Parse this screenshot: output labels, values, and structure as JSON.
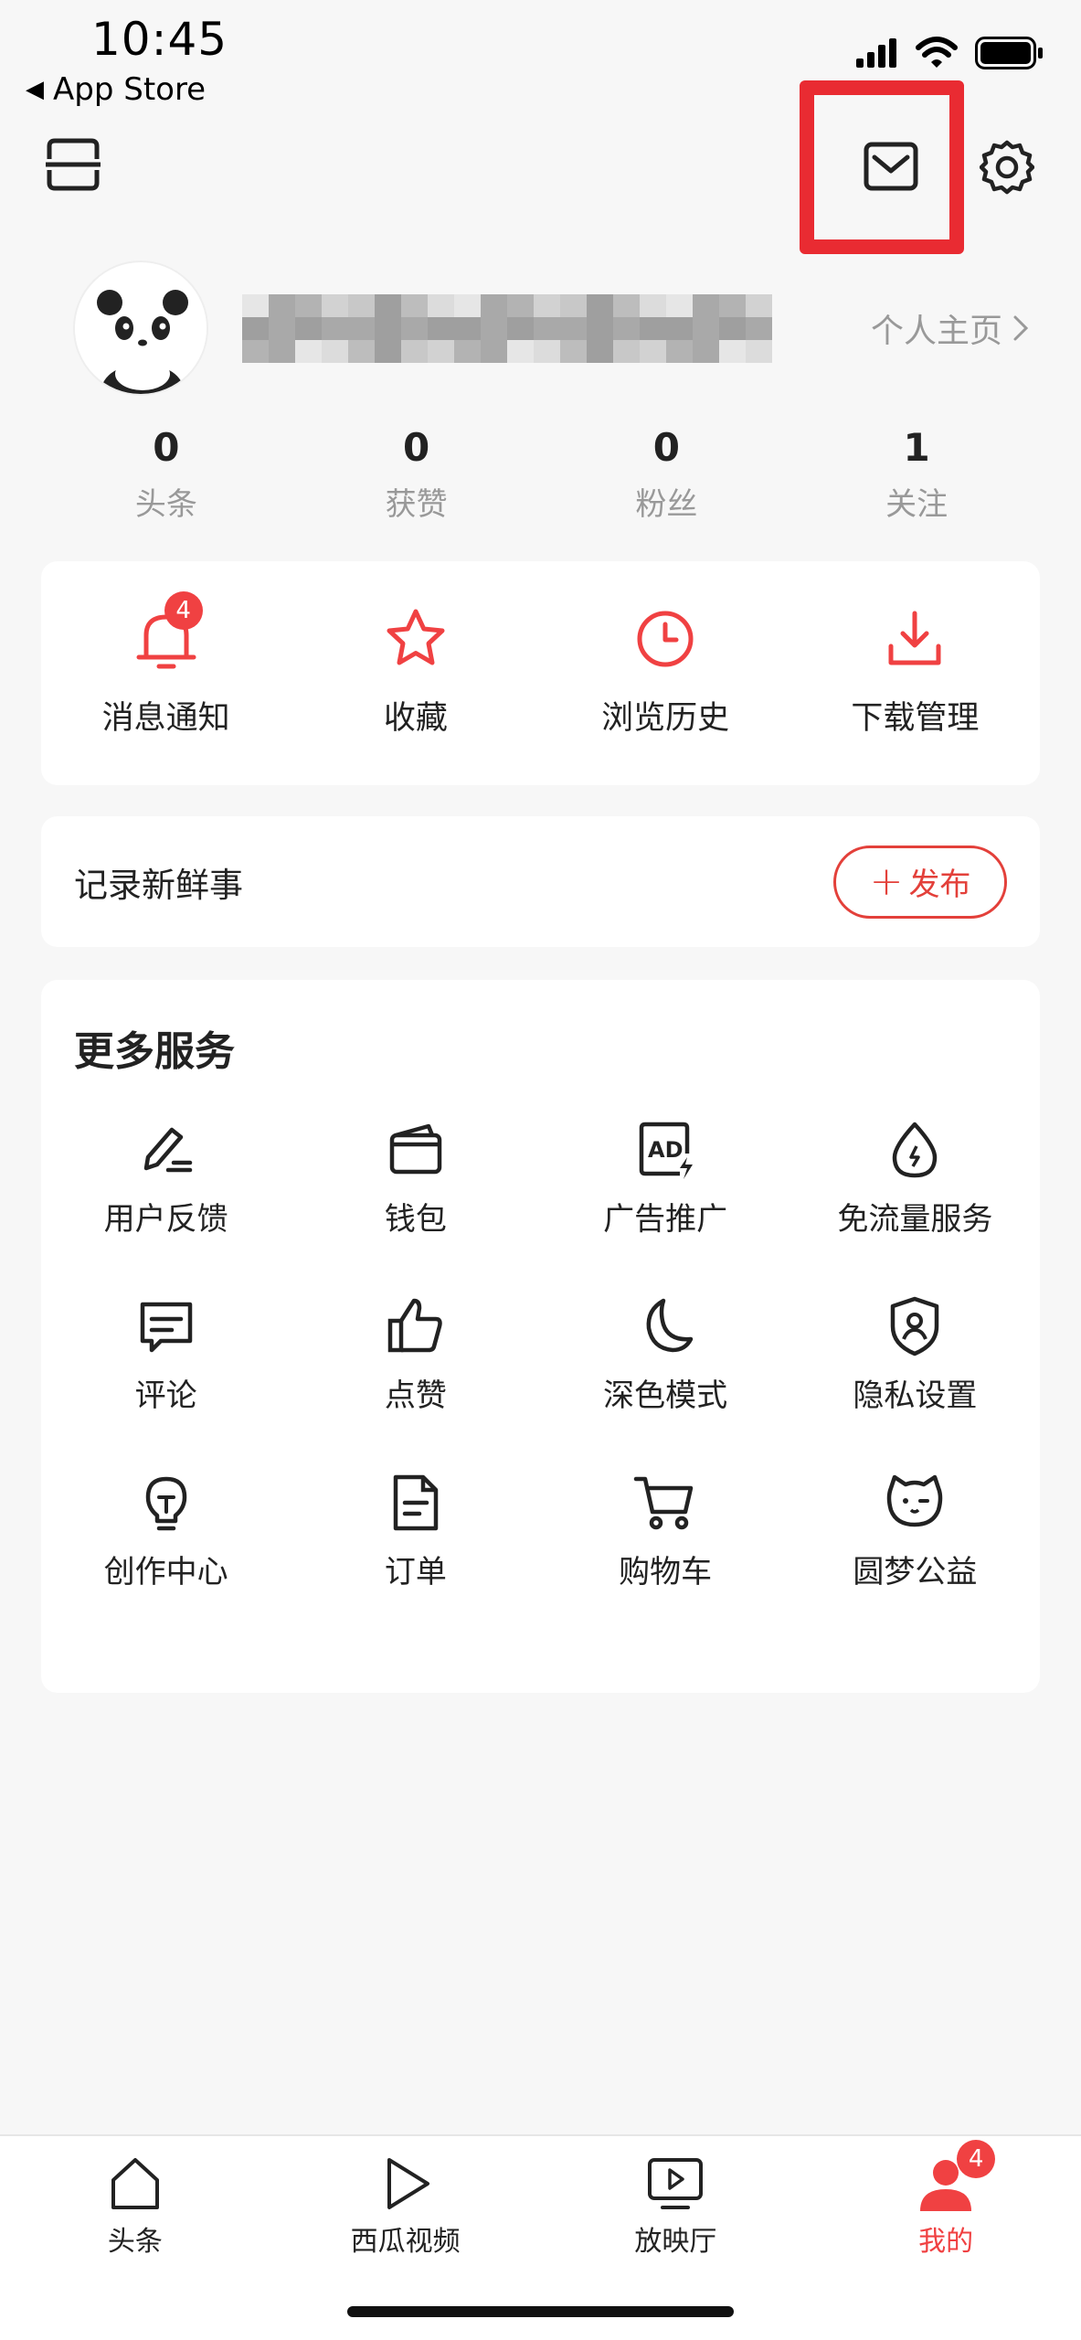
{
  "status_bar": {
    "time": "10:45",
    "back_label": "App Store"
  },
  "profile": {
    "homepage_link": "个人主页"
  },
  "stats": [
    {
      "value": "0",
      "label": "头条"
    },
    {
      "value": "0",
      "label": "获赞"
    },
    {
      "value": "0",
      "label": "粉丝"
    },
    {
      "value": "1",
      "label": "关注"
    }
  ],
  "quick_actions": [
    {
      "label": "消息通知",
      "icon": "bell-icon",
      "badge": "4"
    },
    {
      "label": "收藏",
      "icon": "star-icon"
    },
    {
      "label": "浏览历史",
      "icon": "clock-icon"
    },
    {
      "label": "下载管理",
      "icon": "download-icon"
    }
  ],
  "post": {
    "prompt": "记录新鲜事",
    "publish_label": "发布",
    "publish_plus": "+"
  },
  "services": {
    "title": "更多服务",
    "items": [
      {
        "label": "用户反馈",
        "icon": "pen-icon"
      },
      {
        "label": "钱包",
        "icon": "wallet-icon"
      },
      {
        "label": "广告推广",
        "icon": "ad-icon"
      },
      {
        "label": "免流量服务",
        "icon": "drop-icon"
      },
      {
        "label": "评论",
        "icon": "comment-icon"
      },
      {
        "label": "点赞",
        "icon": "thumbs-up-icon"
      },
      {
        "label": "深色模式",
        "icon": "moon-icon"
      },
      {
        "label": "隐私设置",
        "icon": "shield-icon"
      },
      {
        "label": "创作中心",
        "icon": "bulb-icon"
      },
      {
        "label": "订单",
        "icon": "document-icon"
      },
      {
        "label": "购物车",
        "icon": "cart-icon"
      },
      {
        "label": "圆梦公益",
        "icon": "cat-icon"
      }
    ]
  },
  "tabs": [
    {
      "label": "头条",
      "icon": "home-icon"
    },
    {
      "label": "西瓜视频",
      "icon": "play-icon"
    },
    {
      "label": "放映厅",
      "icon": "tv-icon"
    },
    {
      "label": "我的",
      "icon": "user-icon",
      "badge": "4",
      "active": true
    }
  ],
  "colors": {
    "accent": "#f04142",
    "highlight": "#e92b32",
    "background": "#f7f7f7"
  }
}
